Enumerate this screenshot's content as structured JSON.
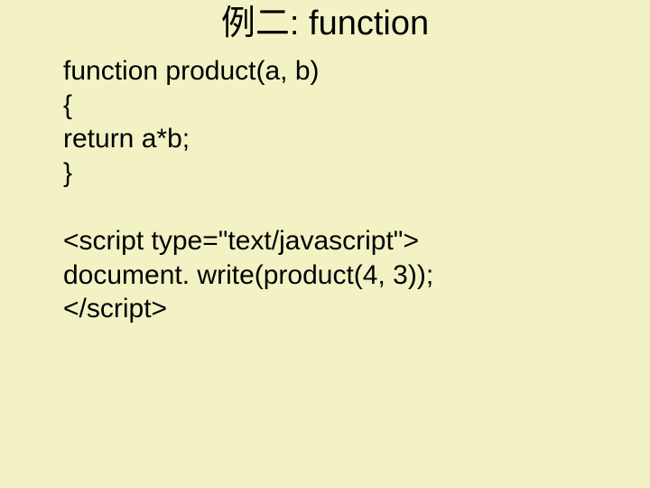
{
  "title": "例二: function",
  "code": {
    "l1": "function product(a, b)",
    "l2": "{",
    "l3": "return a*b;",
    "l4": "}",
    "l5": "<script type=\"text/javascript\">",
    "l6": "document. write(product(4, 3));",
    "l7": "</script>"
  }
}
